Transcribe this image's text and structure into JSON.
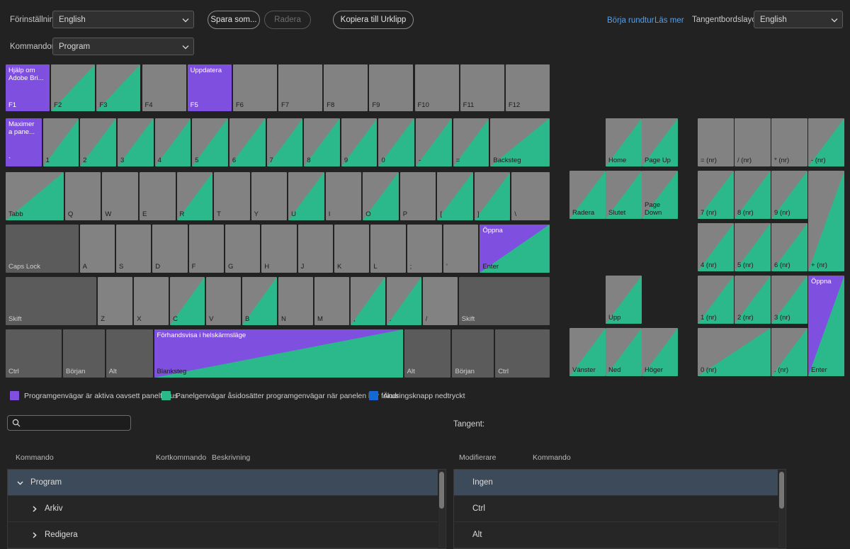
{
  "toolbar": {
    "preset_label": "Förinställning:",
    "preset_value": "English",
    "commands_label": "Kommandon:",
    "commands_value": "Program",
    "save_as_label": "Spara som...",
    "delete_label": "Radera",
    "copy_label": "Kopiera till Urklipp",
    "tour_link": "Börja rundtur",
    "more_link": "Läs mer",
    "layout_label": "Tangentbordslayout:",
    "layout_value": "English"
  },
  "legend": [
    {
      "color": "#7f4fe0",
      "text": "Programgenvägar är aktiva oavsett panelfokus"
    },
    {
      "color": "#2bb98c",
      "text": "Panelgenvägar åsidosätter programgenvägar när panelen har fokus"
    },
    {
      "color": "#1569d6",
      "text": "Ändringsknapp nedtryckt"
    }
  ],
  "search": {
    "placeholder": "",
    "value": "",
    "icon": "search-icon"
  },
  "key_label": "Tangent:",
  "left_table": {
    "headers": [
      "Kommando",
      "Kortkommando",
      "Beskrivning"
    ],
    "rows": [
      {
        "label": "Program",
        "indent": 0,
        "expanded": true,
        "selected": true
      },
      {
        "label": "Arkiv",
        "indent": 1,
        "expanded": false,
        "selected": false
      },
      {
        "label": "Redigera",
        "indent": 1,
        "expanded": false,
        "selected": false
      }
    ]
  },
  "right_table": {
    "headers": [
      "Modifierare",
      "Kommando"
    ],
    "rows": [
      {
        "label": "Ingen",
        "selected": true
      },
      {
        "label": "Ctrl",
        "selected": false
      },
      {
        "label": "Alt",
        "selected": false
      }
    ]
  },
  "colors": {
    "app_shortcut": "#7f4fe0",
    "panel_shortcut": "#2bb98c",
    "modifier_down": "#1569d6",
    "key_face": "#828282",
    "modifier_face": "#5b5b5b",
    "background": "#222222",
    "selection": "#3c4a5a"
  },
  "keyboard": {
    "fn_row": [
      {
        "label": "F1",
        "top": "Hjälp om\nAdobe Bri...",
        "style": "app"
      },
      {
        "label": "F2",
        "style": "teal"
      },
      {
        "label": "F3",
        "style": "teal"
      },
      {
        "label": "F4",
        "style": "plain"
      },
      {
        "label": "F5",
        "top": "Uppdatera",
        "style": "app"
      },
      {
        "label": "F6",
        "style": "plain"
      },
      {
        "label": "F7",
        "style": "plain"
      },
      {
        "label": "F8",
        "style": "plain"
      },
      {
        "label": "F9",
        "style": "plain"
      },
      {
        "label": "F10",
        "style": "plain"
      },
      {
        "label": "F11",
        "style": "plain"
      },
      {
        "label": "F12",
        "style": "plain"
      }
    ],
    "num_row": [
      {
        "label": "`",
        "top": "Maximer\na pane...",
        "style": "app"
      },
      {
        "label": "1",
        "style": "teal"
      },
      {
        "label": "2",
        "style": "teal"
      },
      {
        "label": "3",
        "style": "teal"
      },
      {
        "label": "4",
        "style": "teal"
      },
      {
        "label": "5",
        "style": "teal"
      },
      {
        "label": "6",
        "style": "teal"
      },
      {
        "label": "7",
        "style": "teal"
      },
      {
        "label": "8",
        "style": "teal"
      },
      {
        "label": "9",
        "style": "teal"
      },
      {
        "label": "0",
        "style": "teal"
      },
      {
        "label": "-",
        "style": "teal"
      },
      {
        "label": "=",
        "style": "teal"
      },
      {
        "label": "Backsteg",
        "style": "teal"
      }
    ],
    "tab_row": [
      {
        "label": "Tabb",
        "style": "teal"
      },
      {
        "label": "Q",
        "style": "plain"
      },
      {
        "label": "W",
        "style": "plain"
      },
      {
        "label": "E",
        "style": "plain"
      },
      {
        "label": "R",
        "style": "teal"
      },
      {
        "label": "T",
        "style": "plain"
      },
      {
        "label": "Y",
        "style": "plain"
      },
      {
        "label": "U",
        "style": "teal"
      },
      {
        "label": "I",
        "style": "plain"
      },
      {
        "label": "O",
        "style": "teal"
      },
      {
        "label": "P",
        "style": "plain"
      },
      {
        "label": "[",
        "style": "teal"
      },
      {
        "label": "]",
        "style": "teal"
      },
      {
        "label": "\\",
        "style": "plain"
      }
    ],
    "caps_row": [
      {
        "label": "Caps Lock",
        "style": "mod"
      },
      {
        "label": "A",
        "style": "plain"
      },
      {
        "label": "S",
        "style": "plain"
      },
      {
        "label": "D",
        "style": "plain"
      },
      {
        "label": "F",
        "style": "plain"
      },
      {
        "label": "G",
        "style": "plain"
      },
      {
        "label": "H",
        "style": "plain"
      },
      {
        "label": "J",
        "style": "plain"
      },
      {
        "label": "K",
        "style": "plain"
      },
      {
        "label": "L",
        "style": "plain"
      },
      {
        "label": ";",
        "style": "plain"
      },
      {
        "label": "'",
        "style": "plain"
      },
      {
        "label": "Enter",
        "top": "Öppna",
        "style": "app-teal"
      }
    ],
    "shift_row": [
      {
        "label": "Skift",
        "style": "mod"
      },
      {
        "label": "Z",
        "style": "plain"
      },
      {
        "label": "X",
        "style": "plain"
      },
      {
        "label": "C",
        "style": "teal"
      },
      {
        "label": "V",
        "style": "plain"
      },
      {
        "label": "B",
        "style": "teal"
      },
      {
        "label": "N",
        "style": "plain"
      },
      {
        "label": "M",
        "style": "plain"
      },
      {
        "label": ",",
        "style": "teal"
      },
      {
        "label": ".",
        "style": "teal"
      },
      {
        "label": "/",
        "style": "plain"
      },
      {
        "label": "Skift",
        "style": "mod"
      }
    ],
    "bottom_row": [
      {
        "label": "Ctrl",
        "style": "mod"
      },
      {
        "label": "Början",
        "style": "mod"
      },
      {
        "label": "Alt",
        "style": "mod"
      },
      {
        "label": "Blanksteg",
        "top": "Förhandsvisa i helskärmsläge",
        "style": "app-teal"
      },
      {
        "label": "Alt",
        "style": "mod"
      },
      {
        "label": "Början",
        "style": "mod"
      },
      {
        "label": "Ctrl",
        "style": "mod"
      }
    ],
    "nav_cluster": [
      {
        "label": "Home",
        "style": "teal"
      },
      {
        "label": "Page Up",
        "style": "teal"
      },
      {
        "label": "Radera",
        "style": "teal"
      },
      {
        "label": "Slutet",
        "style": "teal"
      },
      {
        "label": "Page\nDown",
        "style": "teal"
      },
      {
        "label": "Upp",
        "style": "teal"
      },
      {
        "label": "Vänster",
        "style": "teal"
      },
      {
        "label": "Ned",
        "style": "teal"
      },
      {
        "label": "Höger",
        "style": "teal"
      }
    ],
    "numpad": [
      {
        "label": "= (nr)",
        "style": "plain"
      },
      {
        "label": "/ (nr)",
        "style": "plain"
      },
      {
        "label": "* (nr)",
        "style": "plain"
      },
      {
        "label": "- (nr)",
        "style": "teal"
      },
      {
        "label": "7 (nr)",
        "style": "teal"
      },
      {
        "label": "8 (nr)",
        "style": "teal"
      },
      {
        "label": "9 (nr)",
        "style": "teal"
      },
      {
        "label": "+ (nr)",
        "style": "teal"
      },
      {
        "label": "4 (nr)",
        "style": "teal"
      },
      {
        "label": "5 (nr)",
        "style": "teal"
      },
      {
        "label": "6 (nr)",
        "style": "teal"
      },
      {
        "label": "1 (nr)",
        "style": "teal"
      },
      {
        "label": "2 (nr)",
        "style": "teal"
      },
      {
        "label": "3 (nr)",
        "style": "teal"
      },
      {
        "label": "0 (nr)",
        "style": "teal"
      },
      {
        "label": ". (nr)",
        "style": "teal"
      },
      {
        "label": "Enter",
        "top": "Öppna",
        "style": "app-teal"
      }
    ]
  }
}
